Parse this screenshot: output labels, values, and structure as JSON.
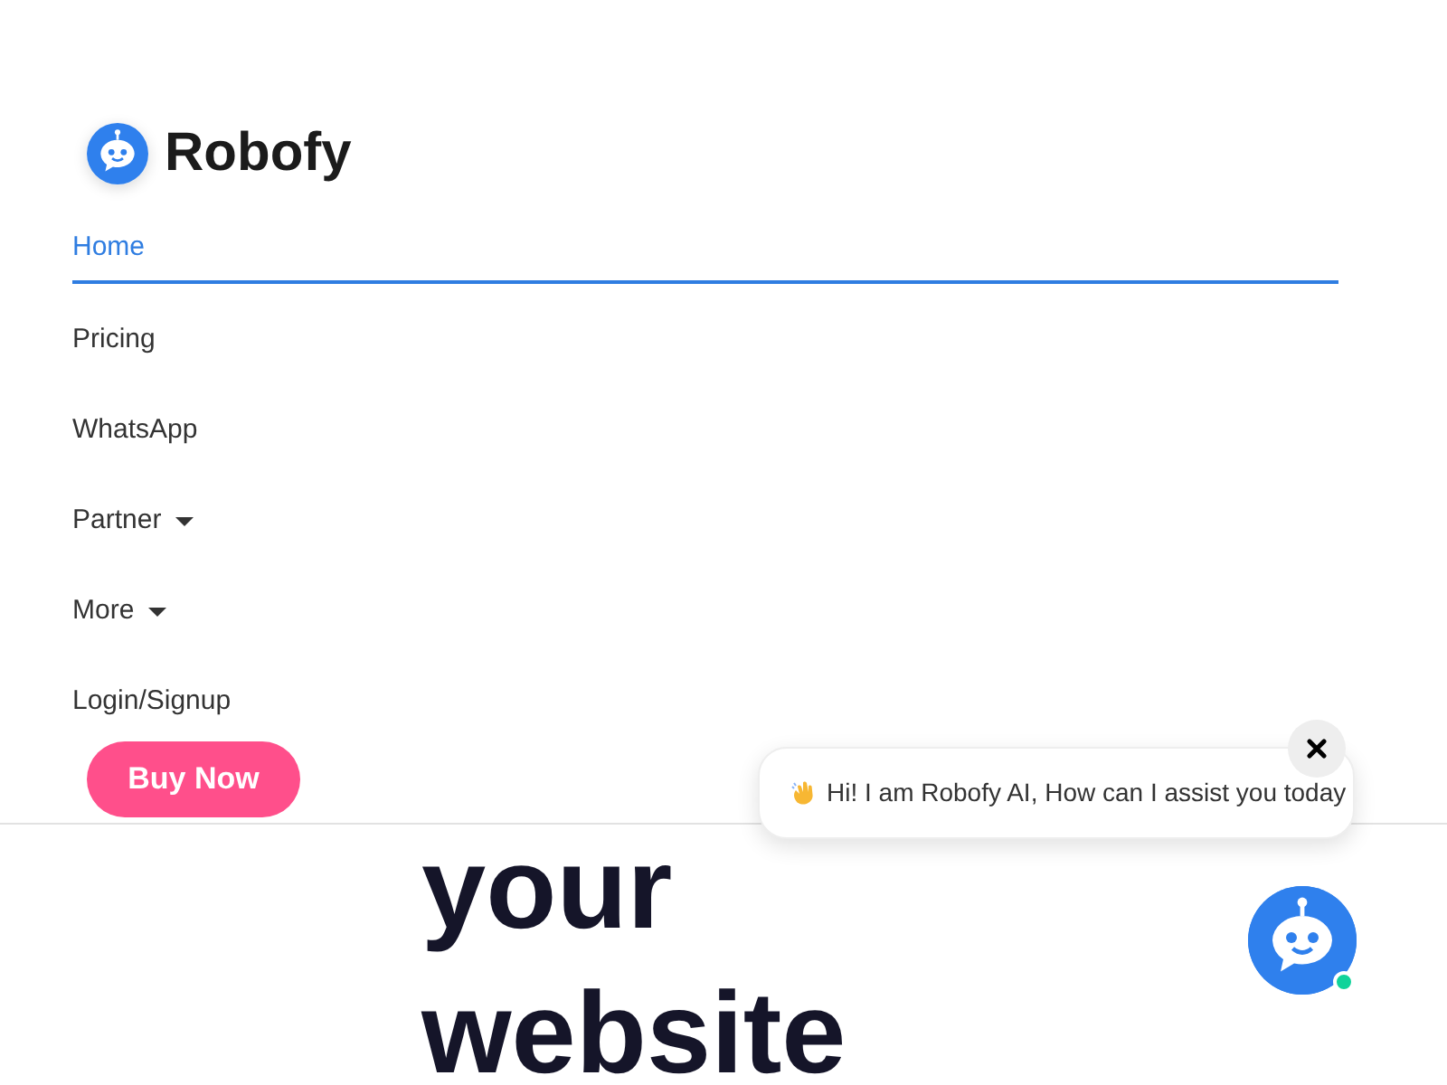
{
  "brand": {
    "name": "Robofy"
  },
  "nav": [
    {
      "label": "Home",
      "selected": true,
      "dropdown": false
    },
    {
      "label": "Pricing",
      "selected": false,
      "dropdown": false
    },
    {
      "label": "WhatsApp",
      "selected": false,
      "dropdown": false
    },
    {
      "label": "Partner",
      "selected": false,
      "dropdown": true
    },
    {
      "label": "More",
      "selected": false,
      "dropdown": true
    },
    {
      "label": "Login/Signup",
      "selected": false,
      "dropdown": false
    }
  ],
  "cta": {
    "label": "Buy Now"
  },
  "hero": {
    "lines": [
      "your",
      "website"
    ]
  },
  "chat": {
    "greeting": "Hi! I am Robofy AI, How can I assist you today",
    "online": true
  }
}
